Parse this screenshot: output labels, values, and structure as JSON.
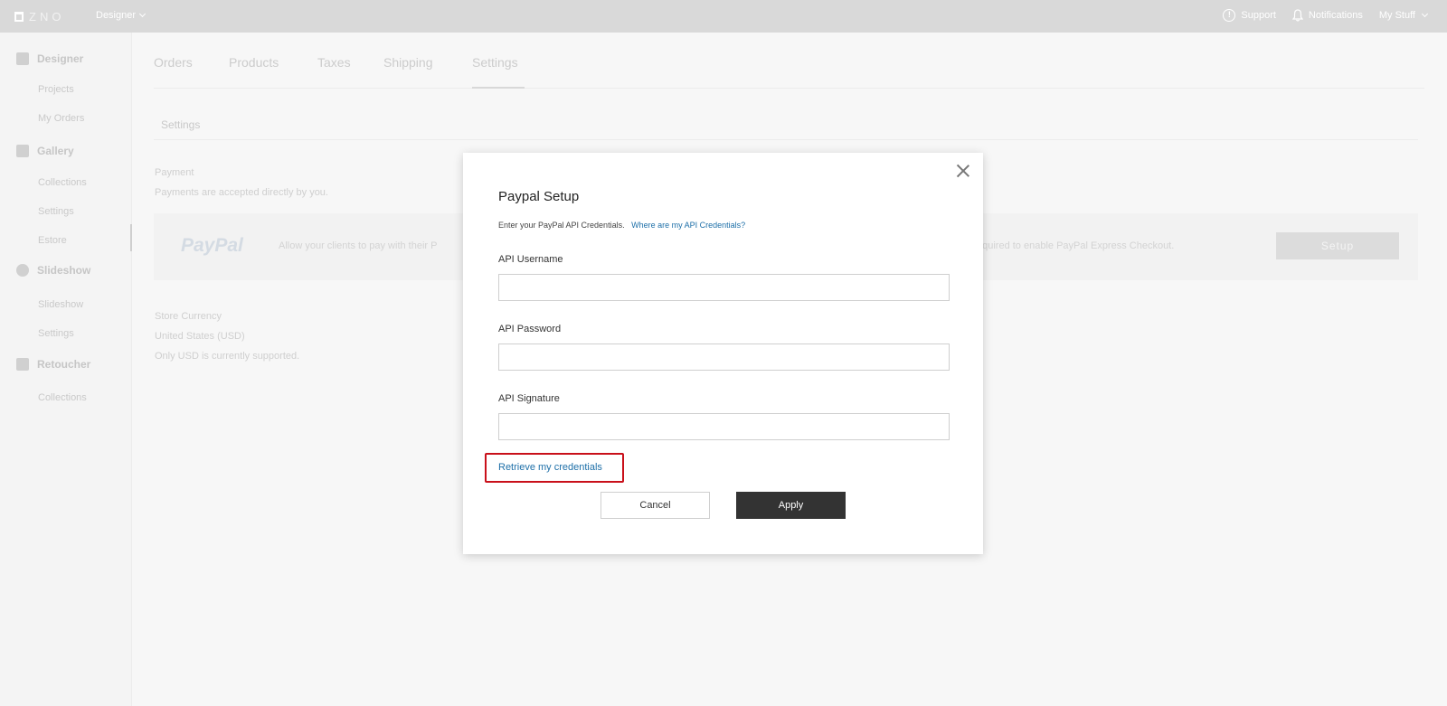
{
  "topbar": {
    "logo_text": "ZNO",
    "app_switch": "Designer",
    "support": "Support",
    "notifications": "Notifications",
    "my_stuff": "My Stuff"
  },
  "sidebar": {
    "sections": [
      {
        "label": "Designer",
        "icon": "designer-icon",
        "items": [
          "Projects",
          "My Orders"
        ]
      },
      {
        "label": "Gallery",
        "icon": "gallery-icon",
        "items": [
          "Collections",
          "Settings",
          "Estore"
        ]
      },
      {
        "label": "Slideshow",
        "icon": "slideshow-icon",
        "items": [
          "Slideshow",
          "Settings"
        ]
      },
      {
        "label": "Retoucher",
        "icon": "retoucher-icon",
        "items": [
          "Collections"
        ]
      }
    ],
    "active_item": "Estore"
  },
  "tabs": [
    "Orders",
    "Products",
    "Taxes",
    "Shipping",
    "Settings"
  ],
  "active_tab": "Settings",
  "settings": {
    "title": "Settings",
    "payment_label": "Payment",
    "payment_desc": "Payments are accepted directly by you.",
    "paypal_logo": "PayPal",
    "paypal_desc_left": "Allow your clients to pay with their P",
    "paypal_desc_right": "equired to enable PayPal Express Checkout.",
    "setup_button": "Setup",
    "currency_label": "Store Currency",
    "currency_value": "United States (USD)",
    "currency_note": "Only USD is currently supported."
  },
  "modal": {
    "title": "Paypal Setup",
    "subtitle": "Enter your PayPal API Credentials.",
    "help_link": "Where are my API Credentials?",
    "fields": [
      {
        "label": "API Username",
        "value": "",
        "placeholder": ""
      },
      {
        "label": "API Password",
        "value": "",
        "placeholder": ""
      },
      {
        "label": "API Signature",
        "value": "",
        "placeholder": ""
      }
    ],
    "retrieve_link": "Retrieve my credentials",
    "cancel_label": "Cancel",
    "apply_label": "Apply",
    "highlight_color": "#c9101a",
    "link_color": "#1d6fa8"
  }
}
